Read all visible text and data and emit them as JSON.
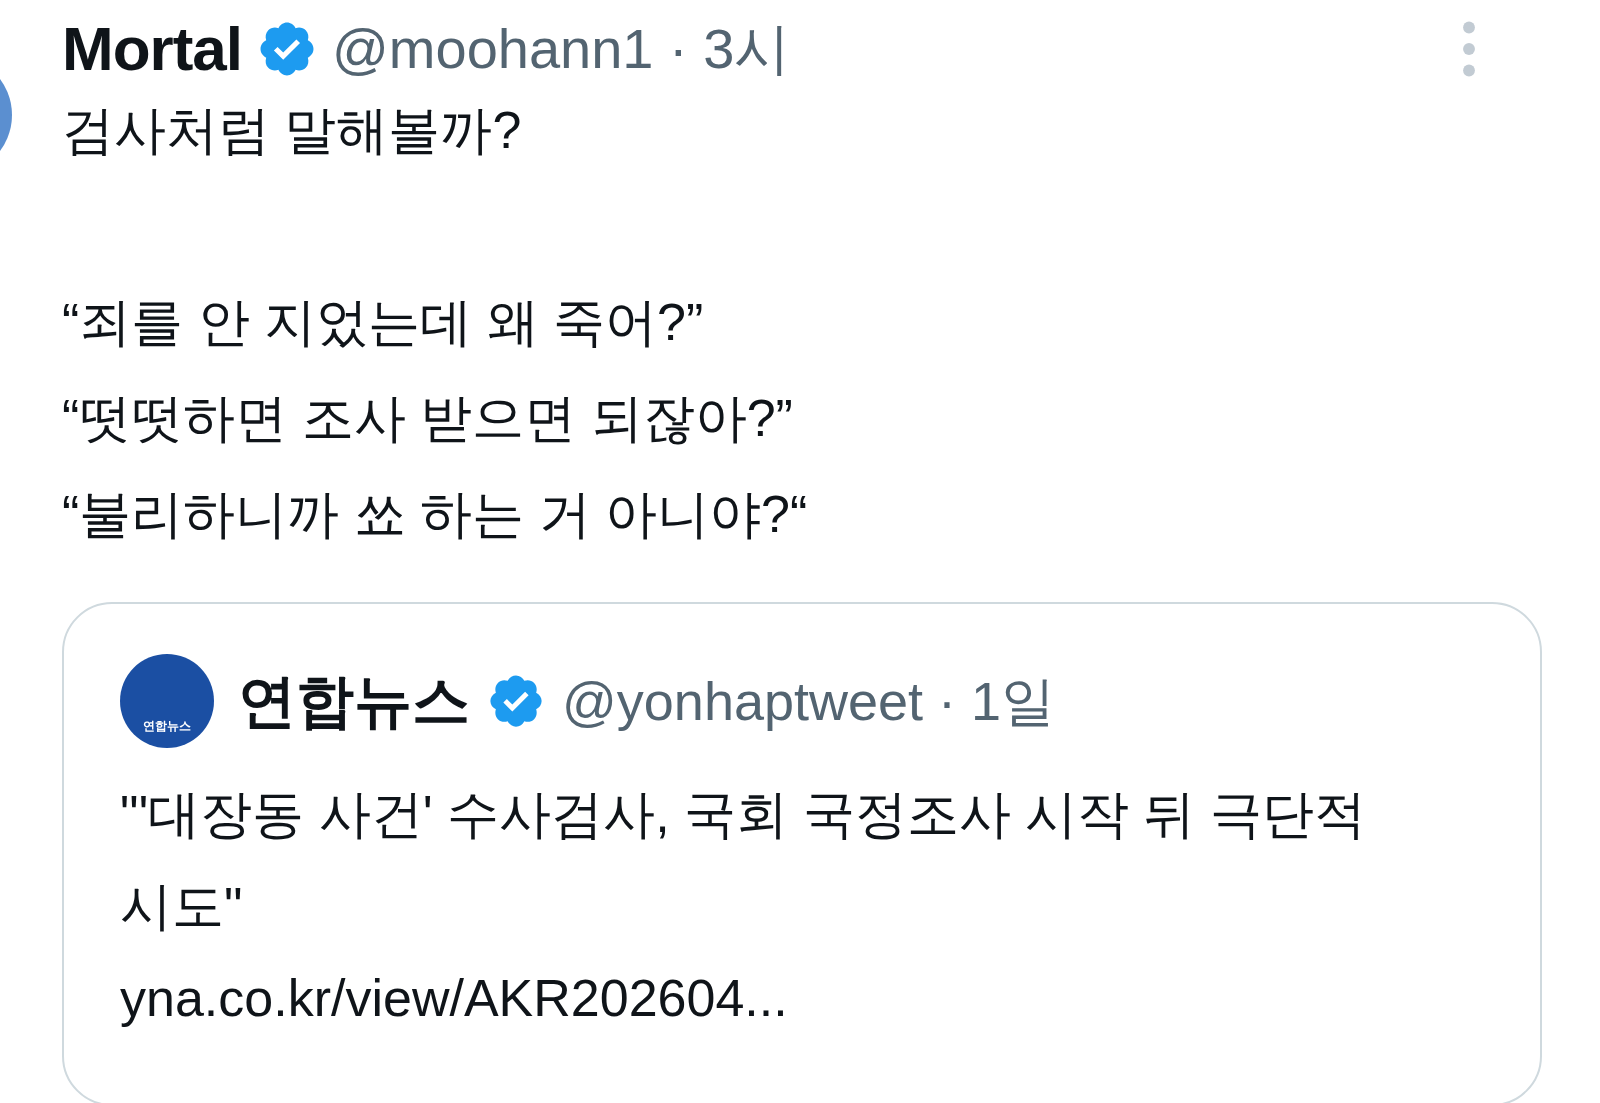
{
  "post": {
    "name": "Mortal",
    "verified": true,
    "handle": "@moohann1",
    "separator": "·",
    "time": "3시",
    "intro": "검사처럼 말해볼까?",
    "lines": [
      "“죄를 안 지었는데 왜 죽어?”",
      "“떳떳하면 조사 받으면 되잖아?”",
      "“불리하니까 쑈 하는 거 아니야?“"
    ]
  },
  "quote": {
    "logo_text": "연합뉴스",
    "name": "연합뉴스",
    "verified": true,
    "handle": "@yonhaptweet",
    "separator": "·",
    "time": "1일",
    "text": "\"'대장동 사건' 수사검사, 국회 국정조사 시작 뒤 극단적 시도\"",
    "link": "yna.co.kr/view/AKR202604..."
  }
}
